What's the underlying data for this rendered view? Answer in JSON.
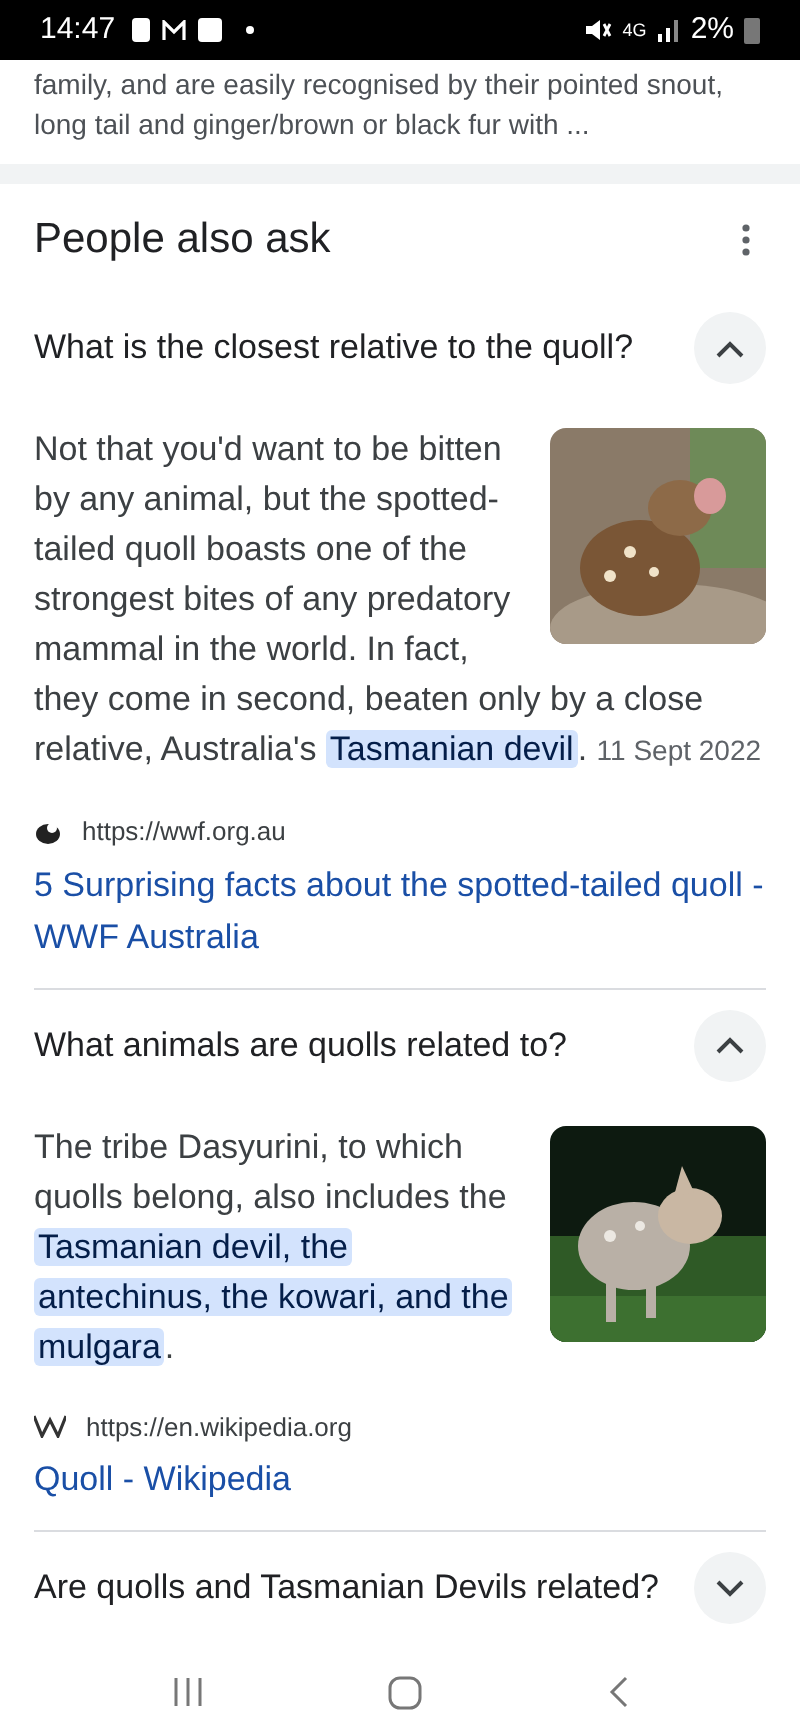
{
  "status_bar": {
    "time": "14:47",
    "battery": "2%",
    "network": "4G"
  },
  "snippet": {
    "lines": [
      "family, and are easily recognised by their pointed snout,",
      "long tail and ginger/brown or black fur with ..."
    ]
  },
  "people_also_ask": {
    "title": "People also ask",
    "questions": [
      {
        "question": "What is the closest relative to the quoll?",
        "expanded": true,
        "answer": {
          "segments": [
            {
              "kind": "plain",
              "text": "Not that you'd want to be bitten by any animal, but the spotted-tailed quoll boasts one of the strongest bites of any predatory mammal in the world. In fact, they come in second, beaten only by a close relative, Australia's "
            },
            {
              "kind": "highlight",
              "text": "Tasmanian devil"
            },
            {
              "kind": "plain",
              "text": ". "
            },
            {
              "kind": "date",
              "text": "11 Sept 2022"
            }
          ],
          "source": {
            "kind": "wwf",
            "url": "https://wwf.org.au",
            "title": "5 Surprising facts about the spotted-tailed quoll - WWF Australia"
          }
        }
      },
      {
        "question": "What animals are quolls related to?",
        "expanded": true,
        "answer": {
          "segments": [
            {
              "kind": "plain",
              "text": "The tribe Dasyurini, to which quolls belong, also includes the "
            },
            {
              "kind": "highlight",
              "text": "Tasmanian devil, the antechinus, the kowari, and the mulgara"
            },
            {
              "kind": "plain",
              "text": "."
            }
          ],
          "source": {
            "kind": "wiki",
            "url": "https://en.wikipedia.org",
            "title": "Quoll - Wikipedia"
          }
        }
      },
      {
        "question": "Are quolls and Tasmanian Devils related?",
        "expanded": false
      }
    ]
  }
}
